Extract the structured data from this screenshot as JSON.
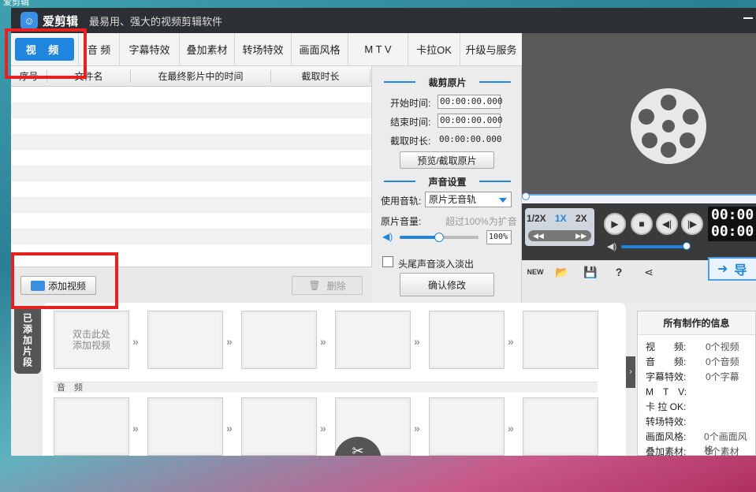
{
  "desktop_label": "爱剪辑",
  "titlebar": {
    "app_name": "爱剪辑",
    "subtitle": "最易用、强大的视频剪辑软件"
  },
  "tabs": [
    {
      "label": "视 频"
    },
    {
      "label": "音 频"
    },
    {
      "label": "字幕特效"
    },
    {
      "label": "叠加素材"
    },
    {
      "label": "转场特效"
    },
    {
      "label": "画面风格"
    },
    {
      "label": "M T V"
    },
    {
      "label": "卡拉OK"
    },
    {
      "label": "升级与服务"
    }
  ],
  "table": {
    "headers": [
      "序号",
      "文件名",
      "在最终影片中的时间",
      "截取时长"
    ],
    "row_count": 11
  },
  "left_footer": {
    "add_video": "添加视频",
    "delete": "删除"
  },
  "trim": {
    "section_title": "裁剪原片",
    "start_label": "开始时间:",
    "start_value": "00:00:00.000",
    "end_label": "结束时间:",
    "end_value": "00:00:00.000",
    "duration_label": "截取时长:",
    "duration_value": "00:00:00.000",
    "preview_button": "预览/截取原片"
  },
  "audio": {
    "section_title": "声音设置",
    "track_label": "使用音轨:",
    "track_value": "原片无音轨",
    "volume_label": "原片音量:",
    "volume_hint": "超过100%为扩音",
    "volume_value": "100%",
    "volume_level": 0.5,
    "fade_label": "头尾声音淡入淡出",
    "confirm": "确认修改"
  },
  "player": {
    "speeds": [
      "1/2X",
      "1X",
      "2X"
    ],
    "current_speed": "1X",
    "time_line1": "00:00:",
    "time_line2": "00:00:",
    "volume_level": 0.95
  },
  "export_label": "导",
  "side_tab": "已添加片段",
  "storyboard": {
    "first_slot_hint_1": "双击此处",
    "first_slot_hint_2": "添加视频",
    "audio_label": "音 频"
  },
  "info": {
    "title": "所有制作的信息",
    "rows": [
      {
        "k": "视　　频:",
        "v": "0个视频"
      },
      {
        "k": "音　　频:",
        "v": "0个音频"
      },
      {
        "k": "字幕特效:",
        "v": "0个字幕"
      },
      {
        "k": "M　T　V:",
        "v": ""
      },
      {
        "k": "卡 拉 OK:",
        "v": ""
      },
      {
        "k": "转场特效:",
        "v": ""
      },
      {
        "k": "画面风格:",
        "v": "0个画面风格"
      },
      {
        "k": "叠加素材:",
        "v": "0个素材"
      }
    ]
  },
  "colors": {
    "accent": "#1f86e0",
    "highlight": "#e82020",
    "titlebar": "#2c2f34"
  }
}
